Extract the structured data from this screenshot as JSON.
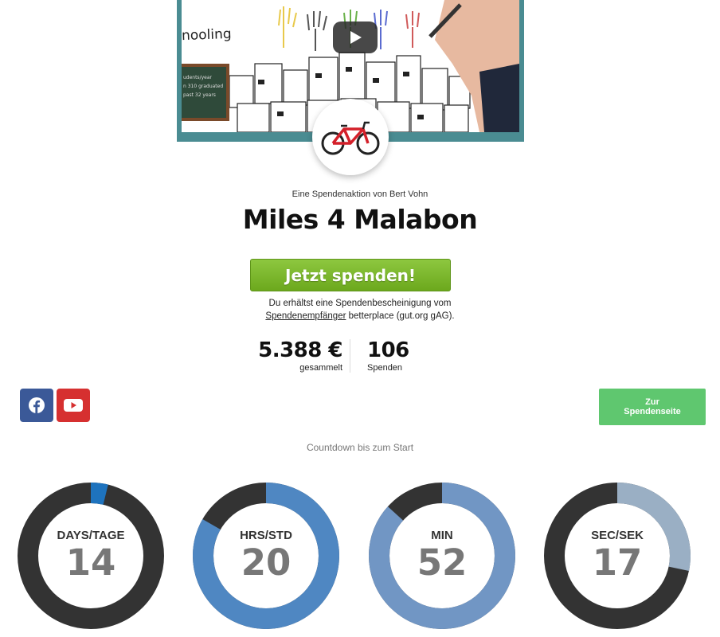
{
  "video": {
    "caption": "nooling",
    "board_lines": [
      "udents/year",
      "n 310 graduated",
      "past 32 years"
    ]
  },
  "campaign": {
    "byline": "Eine Spendenaktion von Bert Vohn",
    "title": "Miles 4 Malabon",
    "donate_label": "Jetzt spenden!",
    "note_line1": "Du erhältst eine Spendenbescheinigung vom",
    "note_link": "Spendenempfänger",
    "note_line2_rest": " betterplace (gut.org gAG).",
    "amount_value": "5.388 €",
    "amount_label": "gesammelt",
    "count_value": "106",
    "count_label": "Spenden"
  },
  "social": {
    "facebook_icon": "facebook-icon",
    "youtube_icon": "youtube-icon",
    "colors": {
      "facebook": "#3b5998",
      "youtube": "#d63030"
    }
  },
  "page_button": {
    "line1": "Zur",
    "line2": "Spendenseite",
    "color": "#5fc76f"
  },
  "countdown": {
    "label": "Countdown bis zum Start",
    "track_color": "#333333",
    "rings": [
      {
        "unit": "DAYS/TAGE",
        "value": "14",
        "progress": 0.038,
        "color": "#1e73be"
      },
      {
        "unit": "HRS/STD",
        "value": "20",
        "progress": 0.833,
        "color": "#4f87c2"
      },
      {
        "unit": "MIN",
        "value": "52",
        "progress": 0.867,
        "color": "#7196c4"
      },
      {
        "unit": "SEC/SEK",
        "value": "17",
        "progress": 0.283,
        "color": "#9aafc4"
      }
    ]
  }
}
